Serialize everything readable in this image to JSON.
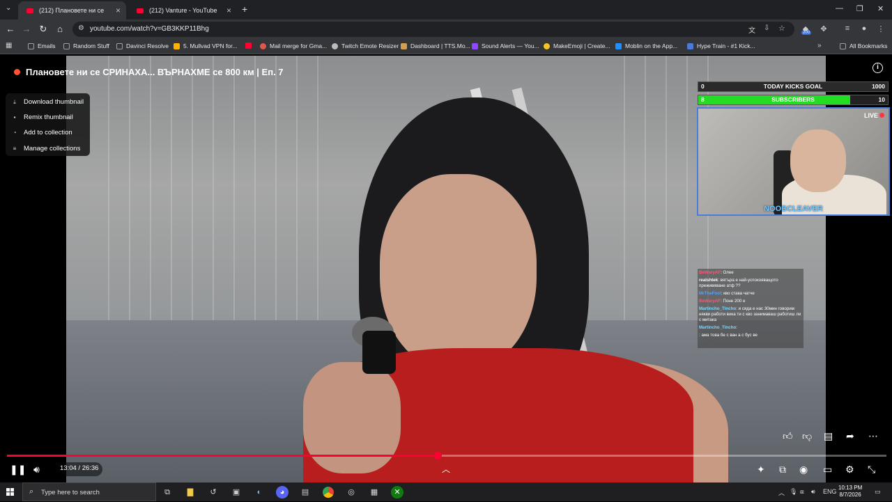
{
  "browser": {
    "tabs": [
      {
        "label": "(212) Плановете ни се",
        "active": true
      },
      {
        "label": "(212) Vanture - YouTube",
        "active": false
      }
    ],
    "new_tab": "+",
    "url": "youtube.com/watch?v=GB3KKP11Bhg",
    "extension_badge": "200"
  },
  "bookmarks": [
    {
      "label": "Emails",
      "color": "#9aa0a6"
    },
    {
      "label": "Random Stuff",
      "color": "#9aa0a6"
    },
    {
      "label": "Davinci Resolve",
      "color": "#9aa0a6"
    },
    {
      "label": "5. Mullvad VPN for...",
      "color": "#ffb000"
    },
    {
      "label": "",
      "color": "#ff0033"
    },
    {
      "label": "Mail merge for Gma...",
      "color": "#e2574c"
    },
    {
      "label": "Twitch Emote Resizer",
      "color": "#bbbbbb"
    },
    {
      "label": "Dashboard | TTS.Mo...",
      "color": "#d0a050"
    },
    {
      "label": "Sound Alerts — You...",
      "color": "#9147ff"
    },
    {
      "label": "MakeEmoji | Create...",
      "color": "#f7c325"
    },
    {
      "label": "Moblin on the App...",
      "color": "#1e90ff"
    },
    {
      "label": "Hype Train - #1 Kick...",
      "color": "#4a7bd8"
    },
    {
      "label": "All Bookmarks",
      "color": "#9aa0a6"
    }
  ],
  "video": {
    "title": "Плановете ни се СРИНАХА... ВЪРНАХМЕ се 800 км | Еп. 7",
    "menu": [
      {
        "label": "Download thumbnail",
        "icon": "download-icon",
        "glyph": "⤓"
      },
      {
        "label": "Remix thumbnail",
        "icon": "remix-icon",
        "glyph": "▪"
      },
      {
        "label": "Add to collection",
        "icon": "collection-add-icon",
        "glyph": "◔"
      },
      {
        "label": "Manage collections",
        "icon": "collections-icon",
        "glyph": "≡"
      }
    ],
    "time": "13:04 / 26:36",
    "progress_fraction": 0.49
  },
  "overlay": {
    "goal1": {
      "left": "0",
      "label": "TODAY KICKS GOAL",
      "right": "1000"
    },
    "goal2": {
      "left": "8",
      "label": "SUBSCRIBERS",
      "right": "10",
      "fill_fraction": 0.8
    },
    "live_label": "LIVE",
    "streamer_name": "NOOBCLEAVER",
    "chat": [
      {
        "user": "BeWaryAF",
        "user_color": "#ff5577",
        "text": ": Олее"
      },
      {
        "user": "realshtek",
        "user_color": "#ffffff",
        "text": ": вятъра е най-успокояващото преживяване атф ??"
      },
      {
        "user": "MrTheFool",
        "user_color": "#5aa0ff",
        "text": ": кво става чатче"
      },
      {
        "user": "BeWaryAF",
        "user_color": "#ff5577",
        "text": ": Поне 200 е"
      },
      {
        "user": "Martincho_Tincho",
        "user_color": "#7fd8ff",
        "text": ": и сяда е нас 30мин говорим някви работи вика ти с кво занимаваш работиш ли с митака"
      },
      {
        "user": "Martincho_Tincho",
        "user_color": "#7fd8ff",
        "text": ":"
      },
      {
        "user": "",
        "user_color": "#ff3366",
        "text": ": ама това бе с ван а с бус ве"
      }
    ]
  },
  "taskbar": {
    "search_placeholder": "Type here to search",
    "lang": "ENG",
    "time": "10:13 PM",
    "date": "8/7/2026"
  }
}
